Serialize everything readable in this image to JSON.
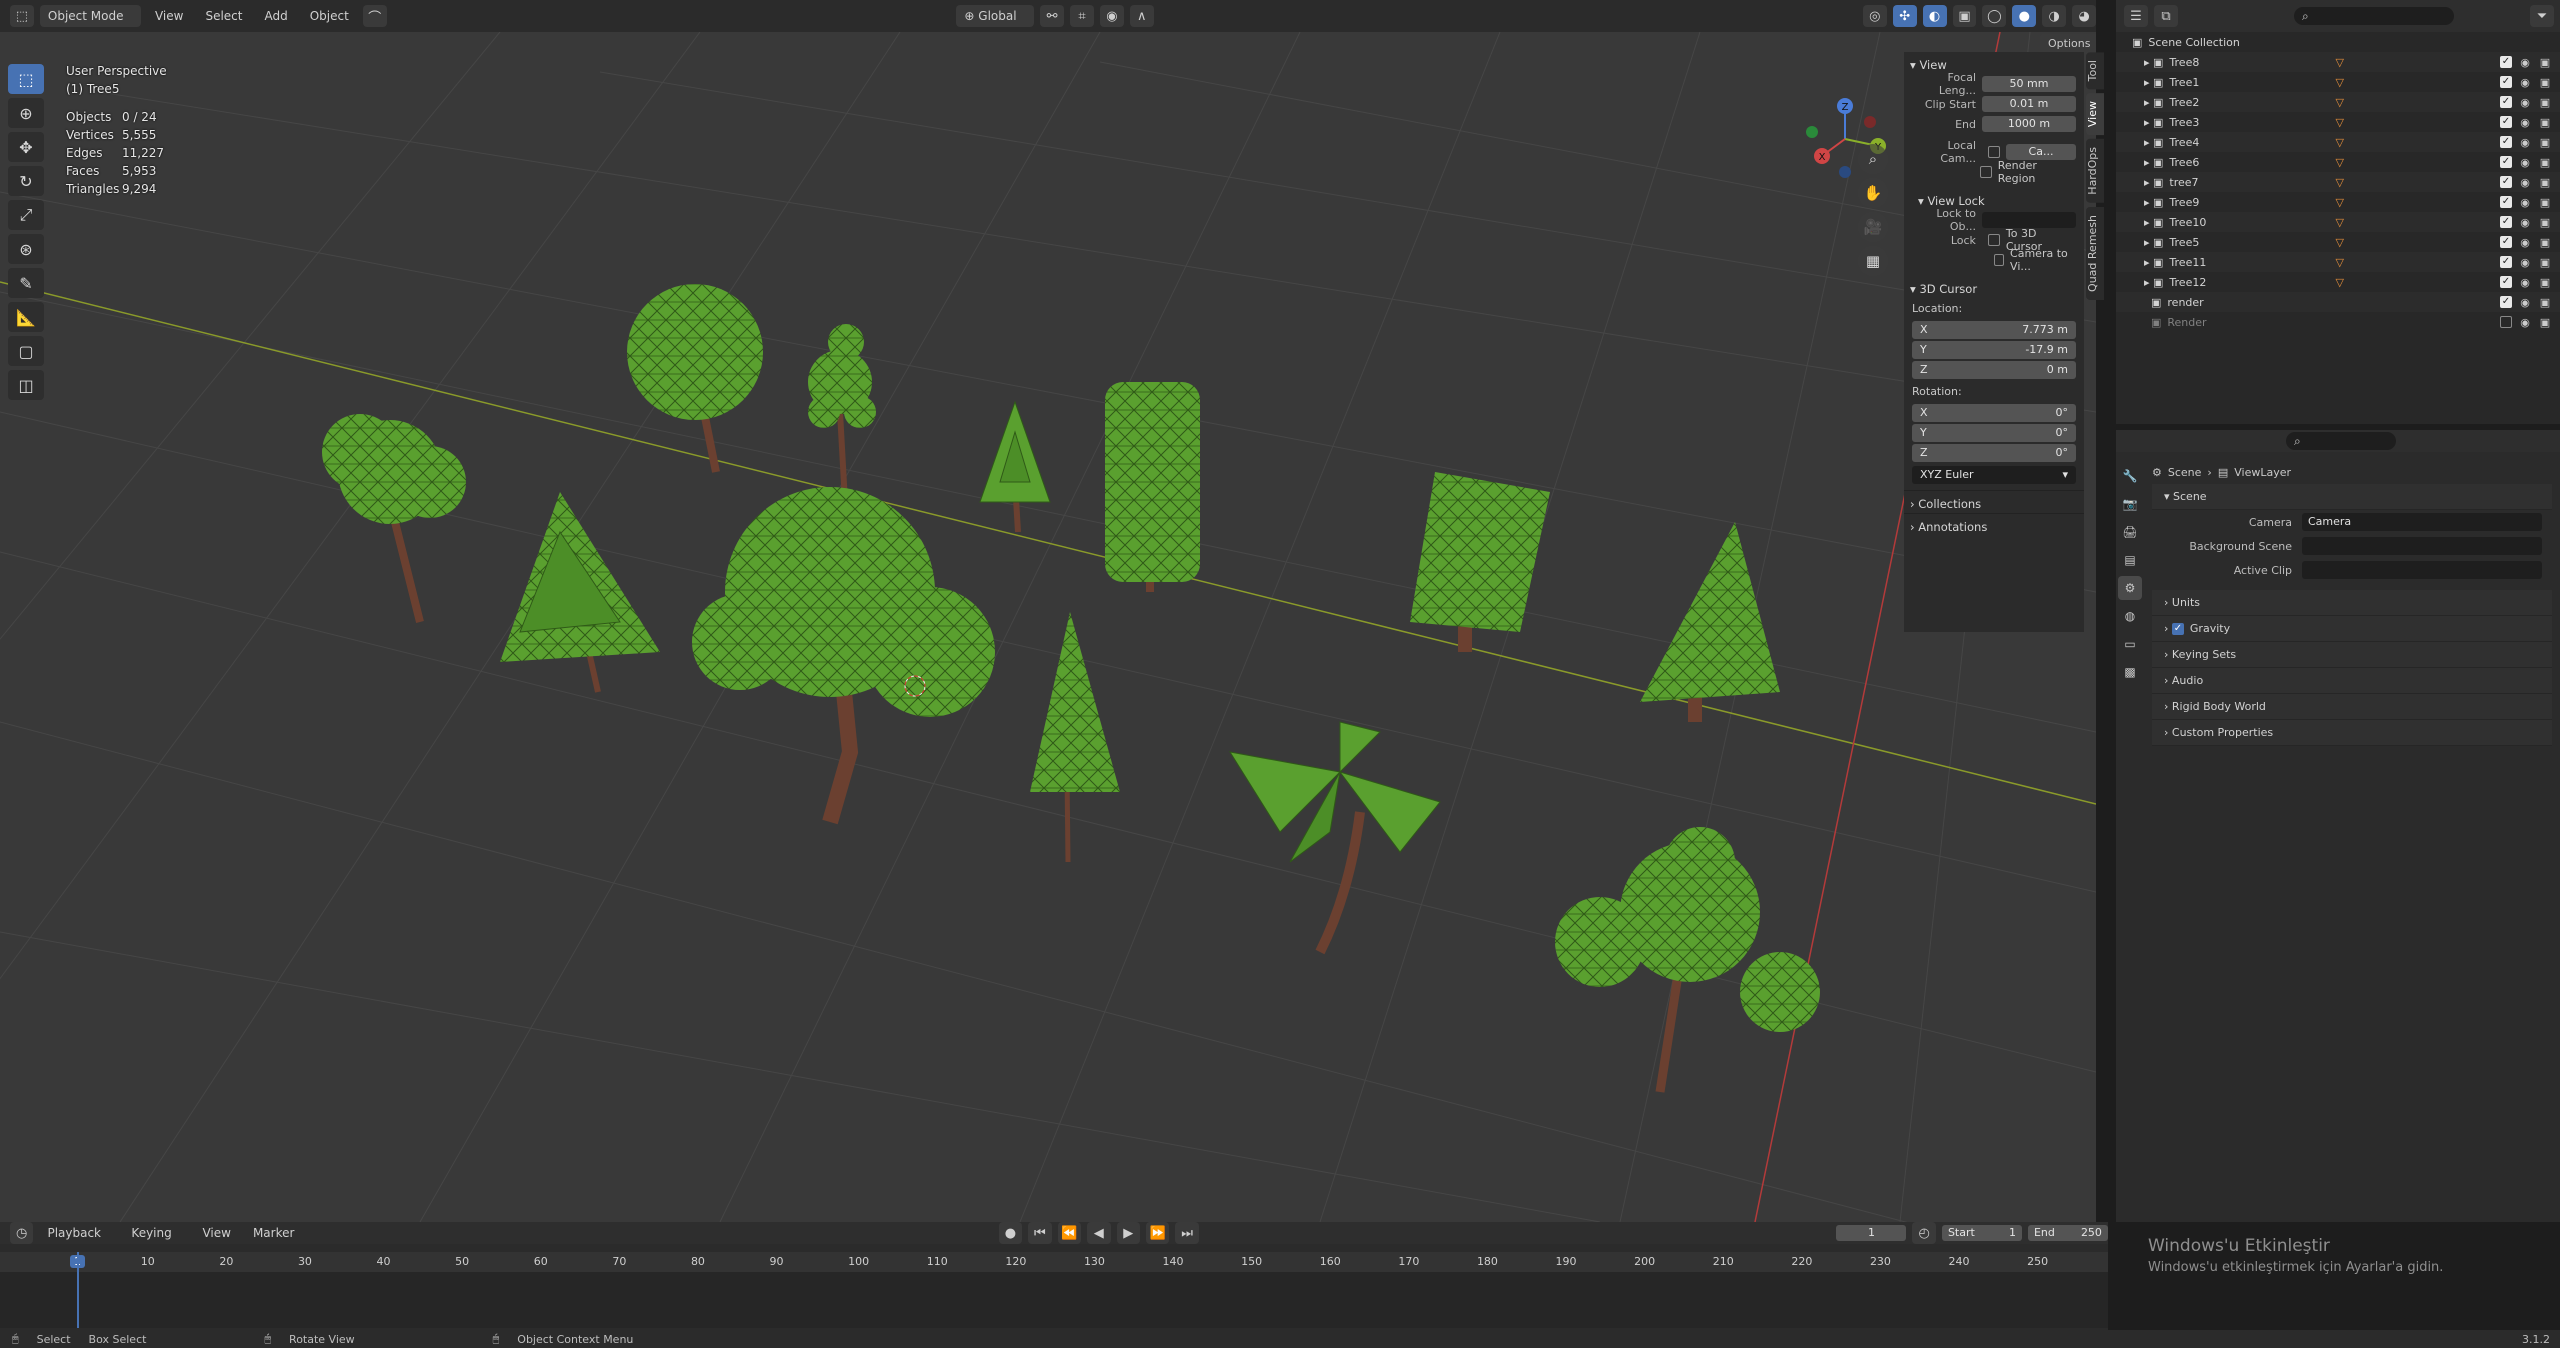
{
  "header": {
    "mode": "Object Mode",
    "menus": [
      "View",
      "Select",
      "Add",
      "Object"
    ],
    "orientation": "Global",
    "options_label": "Options"
  },
  "viewport": {
    "title": "User Perspective",
    "active": "(1) Tree5",
    "stats": [
      {
        "label": "Objects",
        "value": "0 / 24"
      },
      {
        "label": "Vertices",
        "value": "5,555"
      },
      {
        "label": "Edges",
        "value": "11,227"
      },
      {
        "label": "Faces",
        "value": "5,953"
      },
      {
        "label": "Triangles",
        "value": "9,294"
      }
    ]
  },
  "tools": [
    "select-box-icon",
    "cursor-icon",
    "move-icon",
    "rotate-icon",
    "scale-icon",
    "transform-icon",
    "annotate-icon",
    "measure-icon",
    "add-cube-icon",
    "extrude-icon"
  ],
  "gizmo": {
    "x": "X",
    "y": "Y",
    "z": "Z"
  },
  "sidebar_tabs": [
    "Tool",
    "View",
    "HardOps",
    "Quad Remesh"
  ],
  "npanel": {
    "view_header": "View",
    "focal_label": "Focal Leng...",
    "focal_value": "50 mm",
    "clip_start_label": "Clip Start",
    "clip_start_value": "0.01 m",
    "end_label": "End",
    "end_value": "1000 m",
    "local_cam_label": "Local Cam...",
    "local_cam_value": "Ca...",
    "render_region": "Render Region",
    "view_lock_header": "View Lock",
    "lock_to_obj_label": "Lock to Ob...",
    "lock_label": "Lock",
    "to_3d_cursor": "To 3D Cursor",
    "camera_to_view": "Camera to Vi...",
    "cursor_header": "3D Cursor",
    "location_label": "Location:",
    "loc": [
      {
        "axis": "X",
        "value": "7.773 m"
      },
      {
        "axis": "Y",
        "value": "-17.9 m"
      },
      {
        "axis": "Z",
        "value": "0 m"
      }
    ],
    "rotation_label": "Rotation:",
    "rot": [
      {
        "axis": "X",
        "value": "0°"
      },
      {
        "axis": "Y",
        "value": "0°"
      },
      {
        "axis": "Z",
        "value": "0°"
      }
    ],
    "rot_mode": "XYZ Euler",
    "collections": "Collections",
    "annotations": "Annotations"
  },
  "outliner": {
    "root": "Scene Collection",
    "items": [
      "Tree8",
      "Tree1",
      "Tree2",
      "Tree3",
      "Tree4",
      "Tree6",
      "tree7",
      "Tree9",
      "Tree10",
      "Tree5",
      "Tree11",
      "Tree12",
      "render",
      "Render"
    ]
  },
  "properties": {
    "breadcrumb_scene": "Scene",
    "breadcrumb_layer": "ViewLayer",
    "scene_header": "Scene",
    "camera_label": "Camera",
    "camera_value": "Camera",
    "background_label": "Background Scene",
    "active_clip_label": "Active Clip",
    "sections": [
      "Units",
      "Gravity",
      "Keying Sets",
      "Audio",
      "Rigid Body World",
      "Custom Properties"
    ]
  },
  "timeline": {
    "menus": [
      "Playback",
      "Keying",
      "View",
      "Marker"
    ],
    "current_frame": "1",
    "start_label": "Start",
    "start_value": "1",
    "end_label": "End",
    "end_value": "250",
    "ticks": [
      "1",
      "10",
      "20",
      "30",
      "40",
      "50",
      "60",
      "70",
      "80",
      "90",
      "100",
      "110",
      "120",
      "130",
      "140",
      "150",
      "160",
      "170",
      "180",
      "190",
      "200",
      "210",
      "220",
      "230",
      "240",
      "250"
    ]
  },
  "statusbar": {
    "select": "Select",
    "box_select": "Box Select",
    "rotate_view": "Rotate View",
    "context_menu": "Object Context Menu",
    "version": "3.1.2"
  },
  "watermark": {
    "title": "Windows'u Etkinleştir",
    "subtitle": "Windows'u etkinleştirmek için Ayarlar'a gidin."
  },
  "colors": {
    "accent": "#4772b3",
    "foliage": "#5aa02f",
    "trunk": "#6b4030",
    "grid": "#4a4a4a",
    "x_axis": "#b33a3a",
    "y_axis": "#8a9a2a"
  }
}
